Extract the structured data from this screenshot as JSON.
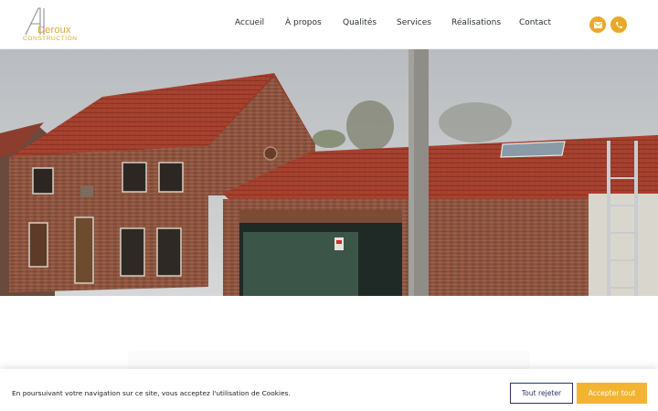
{
  "brand": {
    "logo_letters": "AD",
    "name": "Deroux",
    "subtitle": "CONSTRUCTION",
    "accent_color": "#e9a928"
  },
  "nav": {
    "items": [
      {
        "label": "Accueil"
      },
      {
        "label": "À propos"
      },
      {
        "label": "Qualités"
      },
      {
        "label": "Services"
      },
      {
        "label": "Réalisations"
      },
      {
        "label": "Contact"
      }
    ]
  },
  "header_actions": {
    "email_icon": "envelope-icon",
    "phone_icon": "phone-icon"
  },
  "hero": {
    "image_subject": "brick house with red tiled roof and garage"
  },
  "cookie_banner": {
    "message": "En poursuivant votre navigation sur ce site, vous acceptez l'utilisation de Cookies.",
    "reject_label": "Tout rejeter",
    "accept_label": "Accepter tout",
    "reject_color": "#27355e",
    "accept_color": "#f3b531"
  }
}
